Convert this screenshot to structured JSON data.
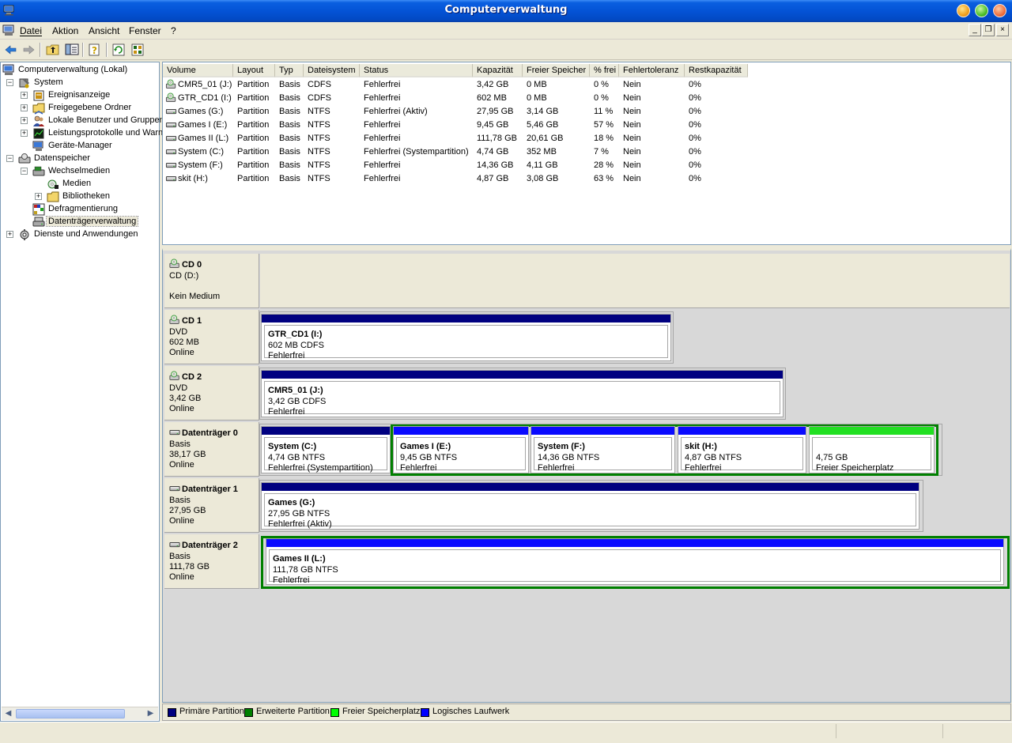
{
  "window": {
    "title": "Computerverwaltung"
  },
  "menu": {
    "items": [
      "Datei",
      "Aktion",
      "Ansicht",
      "Fenster",
      "?"
    ],
    "mdi_buttons": [
      "_",
      "❐",
      "×"
    ]
  },
  "toolbar": {
    "buttons": [
      "back-icon",
      "forward-icon",
      "up-folder-icon",
      "show-hide-tree-icon",
      "help-icon",
      "refresh-icon",
      "properties-icon"
    ]
  },
  "tree": {
    "nodes": [
      {
        "label": "Computerverwaltung (Lokal)",
        "icon": "computer-icon",
        "level": 0,
        "expander": ""
      },
      {
        "label": "System",
        "icon": "system-tools-icon",
        "level": 1,
        "expander": "−"
      },
      {
        "label": "Ereignisanzeige",
        "icon": "event-viewer-icon",
        "level": 2,
        "expander": "+"
      },
      {
        "label": "Freigegebene Ordner",
        "icon": "shared-folder-icon",
        "level": 2,
        "expander": "+"
      },
      {
        "label": "Lokale Benutzer und Gruppen",
        "icon": "users-icon",
        "level": 2,
        "expander": "+"
      },
      {
        "label": "Leistungsprotokolle und Warnungen",
        "icon": "performance-icon",
        "level": 2,
        "expander": "+"
      },
      {
        "label": "Geräte-Manager",
        "icon": "device-manager-icon",
        "level": 2,
        "expander": ""
      },
      {
        "label": "Datenspeicher",
        "icon": "storage-icon",
        "level": 1,
        "expander": "−"
      },
      {
        "label": "Wechselmedien",
        "icon": "removable-media-icon",
        "level": 2,
        "expander": "−"
      },
      {
        "label": "Medien",
        "icon": "media-icon",
        "level": 3,
        "expander": ""
      },
      {
        "label": "Bibliotheken",
        "icon": "folder-icon",
        "level": 3,
        "expander": "+"
      },
      {
        "label": "Defragmentierung",
        "icon": "defrag-icon",
        "level": 2,
        "expander": ""
      },
      {
        "label": "Datenträgerverwaltung",
        "icon": "disk-management-icon",
        "level": 2,
        "expander": "",
        "selected": true
      },
      {
        "label": "Dienste und Anwendungen",
        "icon": "services-icon",
        "level": 1,
        "expander": "+"
      }
    ]
  },
  "volume_list": {
    "columns": [
      "Volume",
      "Layout",
      "Typ",
      "Dateisystem",
      "Status",
      "Kapazität",
      "Freier Speicher",
      "% frei",
      "Fehlertoleranz",
      "Restkapazität"
    ],
    "rows": [
      {
        "icon": "cd-drive-icon",
        "cells": [
          "CMR5_01 (J:)",
          "Partition",
          "Basis",
          "CDFS",
          "Fehlerfrei",
          "3,42 GB",
          "0 MB",
          "0 %",
          "Nein",
          "0%"
        ]
      },
      {
        "icon": "cd-drive-icon",
        "cells": [
          "GTR_CD1 (I:)",
          "Partition",
          "Basis",
          "CDFS",
          "Fehlerfrei",
          "602 MB",
          "0 MB",
          "0 %",
          "Nein",
          "0%"
        ]
      },
      {
        "icon": "hard-disk-icon",
        "cells": [
          "Games (G:)",
          "Partition",
          "Basis",
          "NTFS",
          "Fehlerfrei (Aktiv)",
          "27,95 GB",
          "3,14 GB",
          "11 %",
          "Nein",
          "0%"
        ]
      },
      {
        "icon": "hard-disk-icon",
        "cells": [
          "Games I (E:)",
          "Partition",
          "Basis",
          "NTFS",
          "Fehlerfrei",
          "9,45 GB",
          "5,46 GB",
          "57 %",
          "Nein",
          "0%"
        ]
      },
      {
        "icon": "hard-disk-icon",
        "cells": [
          "Games II (L:)",
          "Partition",
          "Basis",
          "NTFS",
          "Fehlerfrei",
          "111,78 GB",
          "20,61 GB",
          "18 %",
          "Nein",
          "0%"
        ]
      },
      {
        "icon": "hard-disk-icon",
        "cells": [
          "System (C:)",
          "Partition",
          "Basis",
          "NTFS",
          "Fehlerfrei (Systempartition)",
          "4,74 GB",
          "352 MB",
          "7 %",
          "Nein",
          "0%"
        ]
      },
      {
        "icon": "hard-disk-icon",
        "cells": [
          "System (F:)",
          "Partition",
          "Basis",
          "NTFS",
          "Fehlerfrei",
          "14,36 GB",
          "4,11 GB",
          "28 %",
          "Nein",
          "0%"
        ]
      },
      {
        "icon": "hard-disk-icon",
        "cells": [
          "skit (H:)",
          "Partition",
          "Basis",
          "NTFS",
          "Fehlerfrei",
          "4,87 GB",
          "3,08 GB",
          "63 %",
          "Nein",
          "0%"
        ]
      }
    ]
  },
  "disks": [
    {
      "name": "CD 0",
      "icon": "cd-drive-icon",
      "lines": [
        "CD (D:)",
        "",
        "Kein Medium"
      ],
      "partitions": []
    },
    {
      "name": "CD 1",
      "icon": "cd-drive-icon",
      "lines": [
        "DVD",
        "602 MB",
        "Online"
      ],
      "partitions": [
        {
          "name": "GTR_CD1  (I:)",
          "info": "602 MB CDFS",
          "status": "Fehlerfrei",
          "kind": "primary"
        }
      ]
    },
    {
      "name": "CD 2",
      "icon": "cd-drive-icon",
      "lines": [
        "DVD",
        "3,42 GB",
        "Online"
      ],
      "partitions": [
        {
          "name": "CMR5_01  (J:)",
          "info": "3,42 GB CDFS",
          "status": "Fehlerfrei",
          "kind": "primary"
        }
      ]
    },
    {
      "name": "Datenträger 0",
      "icon": "hard-disk-icon",
      "lines": [
        "Basis",
        "38,17 GB",
        "Online"
      ],
      "partitions": [
        {
          "name": "System  (C:)",
          "info": "4,74 GB NTFS",
          "status": "Fehlerfrei (Systempartition)",
          "kind": "primary"
        },
        {
          "name": "Games I  (E:)",
          "info": "9,45 GB NTFS",
          "status": "Fehlerfrei",
          "kind": "logical"
        },
        {
          "name": "System  (F:)",
          "info": "14,36 GB NTFS",
          "status": "Fehlerfrei",
          "kind": "logical"
        },
        {
          "name": "skit  (H:)",
          "info": "4,87 GB NTFS",
          "status": "Fehlerfrei",
          "kind": "logical"
        },
        {
          "name": "",
          "info": "4,75 GB",
          "status": "Freier Speicherplatz",
          "kind": "free"
        }
      ]
    },
    {
      "name": "Datenträger 1",
      "icon": "hard-disk-icon",
      "lines": [
        "Basis",
        "27,95 GB",
        "Online"
      ],
      "partitions": [
        {
          "name": "Games  (G:)",
          "info": "27,95 GB NTFS",
          "status": "Fehlerfrei (Aktiv)",
          "kind": "primary"
        }
      ]
    },
    {
      "name": "Datenträger 2",
      "icon": "hard-disk-icon",
      "lines": [
        "Basis",
        "111,78 GB",
        "Online"
      ],
      "partitions": [
        {
          "name": "Games II  (L:)",
          "info": "111,78 GB NTFS",
          "status": "Fehlerfrei",
          "kind": "logical"
        }
      ]
    }
  ],
  "legend": [
    {
      "label": "Primäre Partition",
      "color": "#000080"
    },
    {
      "label": "Erweiterte Partition",
      "color": "#008000"
    },
    {
      "label": "Freier Speicherplatz",
      "color": "#00ff00"
    },
    {
      "label": "Logisches Laufwerk",
      "color": "#0000ff"
    }
  ],
  "colors": {
    "primary": "#000080",
    "extended": "#008000",
    "free": "#22e022",
    "logical": "#0a0aff"
  }
}
